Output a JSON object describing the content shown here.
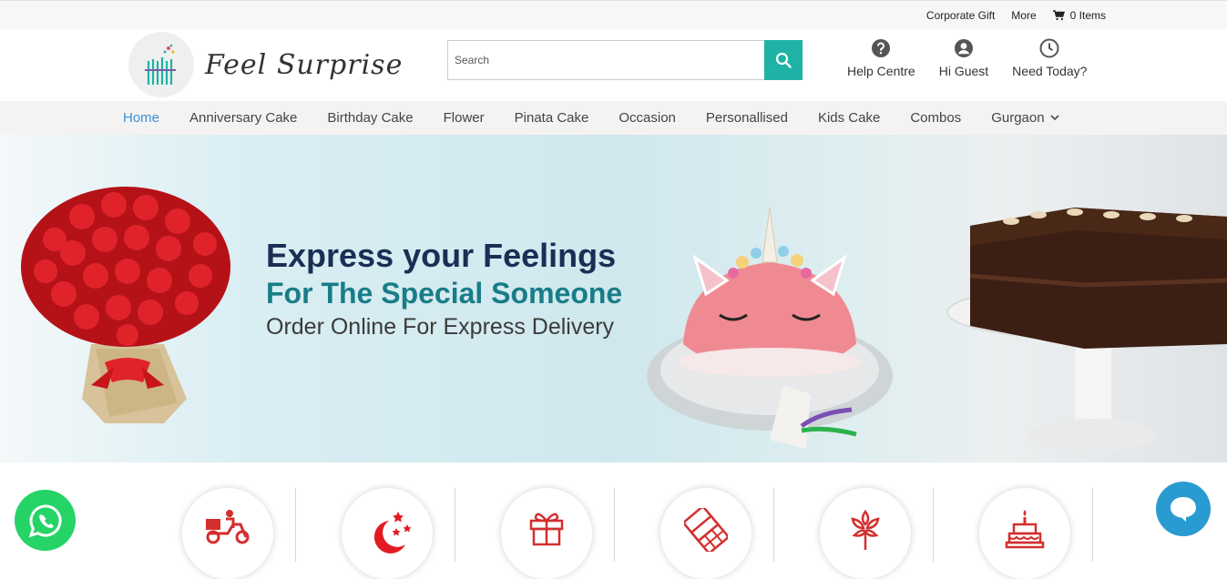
{
  "topbar": {
    "corporate_gift": "Corporate Gift",
    "more": "More",
    "cart_label": "0 Items"
  },
  "header": {
    "logo_text": "Feel Surprise",
    "search_placeholder": "Search",
    "actions": [
      {
        "label": "Help Centre",
        "icon": "question-circle-icon"
      },
      {
        "label": "Hi Guest",
        "icon": "user-circle-icon"
      },
      {
        "label": "Need Today?",
        "icon": "clock-icon"
      }
    ]
  },
  "nav": {
    "items": [
      {
        "label": "Home"
      },
      {
        "label": "Anniversary Cake"
      },
      {
        "label": "Birthday Cake"
      },
      {
        "label": "Flower"
      },
      {
        "label": "Pinata Cake"
      },
      {
        "label": "Occasion"
      },
      {
        "label": "Personallised"
      },
      {
        "label": "Kids Cake"
      },
      {
        "label": "Combos"
      },
      {
        "label": "Gurgaon"
      }
    ],
    "active_index": 0
  },
  "banner": {
    "line1": "Express your Feelings",
    "line2": "For The Special Someone",
    "line3": "Order Online For Express Delivery"
  },
  "features": [
    {
      "icon": "delivery-scooter-icon"
    },
    {
      "icon": "midnight-moon-icon"
    },
    {
      "icon": "gift-box-icon"
    },
    {
      "icon": "chocolate-bar-icon"
    },
    {
      "icon": "flower-icon"
    },
    {
      "icon": "birthday-cake-icon"
    }
  ],
  "colors": {
    "accent": "#1fb2a6",
    "nav_active": "#3b8fd6",
    "feature_icon": "#d32f2f",
    "whatsapp": "#25d366",
    "chat": "#2a9bd1"
  }
}
